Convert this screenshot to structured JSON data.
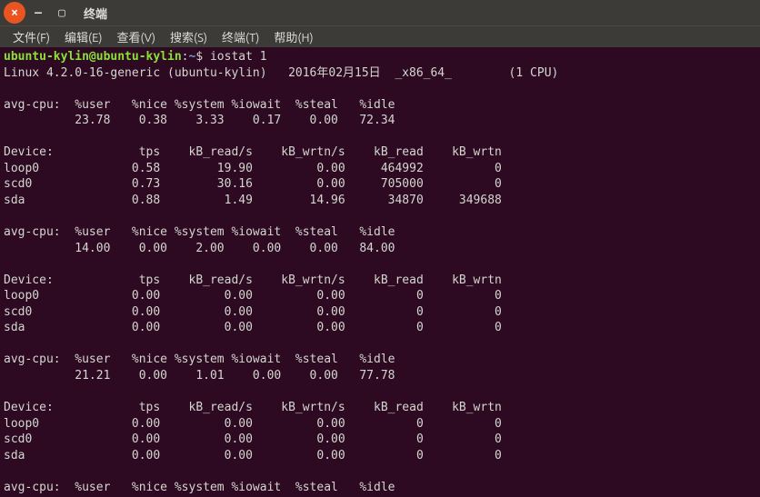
{
  "titlebar_label": "终端",
  "menu": [
    "文件(F)",
    "编辑(E)",
    "查看(V)",
    "搜索(S)",
    "终端(T)",
    "帮助(H)"
  ],
  "prompt": {
    "user_host": "ubuntu-kylin@ubuntu-kylin",
    "colon": ":",
    "path": "~",
    "dollar": "$ ",
    "command": "iostat 1"
  },
  "sysline": "Linux 4.2.0-16-generic (ubuntu-kylin)   2016年02月15日  _x86_64_        (1 CPU)",
  "cpu_hdr": "avg-cpu:  %user   %nice %system %iowait  %steal   %idle",
  "dev_hdr": "Device:            tps    kB_read/s    kB_wrtn/s    kB_read    kB_wrtn",
  "samples": [
    {
      "cpu": "          23.78    0.38    3.33    0.17    0.00   72.34",
      "devs": [
        "loop0             0.58        19.90         0.00     464992          0",
        "scd0              0.73        30.16         0.00     705000          0",
        "sda               0.88         1.49        14.96      34870     349688"
      ]
    },
    {
      "cpu": "          14.00    0.00    2.00    0.00    0.00   84.00",
      "devs": [
        "loop0             0.00         0.00         0.00          0          0",
        "scd0              0.00         0.00         0.00          0          0",
        "sda               0.00         0.00         0.00          0          0"
      ]
    },
    {
      "cpu": "          21.21    0.00    1.01    0.00    0.00   77.78",
      "devs": [
        "loop0             0.00         0.00         0.00          0          0",
        "scd0              0.00         0.00         0.00          0          0",
        "sda               0.00         0.00         0.00          0          0"
      ]
    }
  ]
}
